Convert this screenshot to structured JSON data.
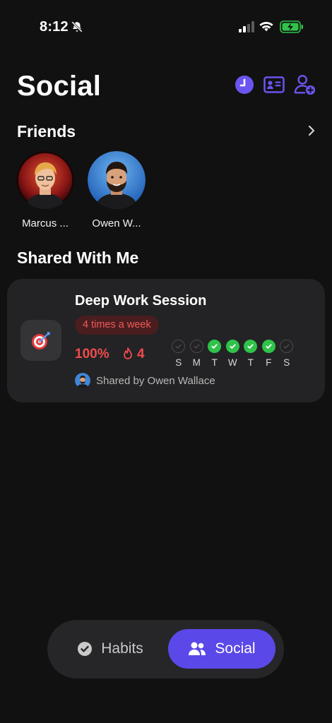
{
  "status_bar": {
    "time": "8:12"
  },
  "header": {
    "title": "Social"
  },
  "friends": {
    "title": "Friends",
    "items": [
      {
        "name": "Marcus ..."
      },
      {
        "name": "Owen W..."
      }
    ]
  },
  "shared": {
    "title": "Shared With Me",
    "habit": {
      "name": "Deep Work Session",
      "frequency": "4 times a week",
      "percent": "100%",
      "streak": "4",
      "days": [
        {
          "label": "S",
          "done": false
        },
        {
          "label": "M",
          "done": false
        },
        {
          "label": "T",
          "done": true
        },
        {
          "label": "W",
          "done": true
        },
        {
          "label": "T",
          "done": true
        },
        {
          "label": "F",
          "done": true
        },
        {
          "label": "S",
          "done": false
        }
      ],
      "shared_by": "Shared by Owen Wallace"
    }
  },
  "tabs": [
    {
      "label": "Habits",
      "active": false
    },
    {
      "label": "Social",
      "active": true
    }
  ],
  "colors": {
    "accent": "#5b48e8",
    "background": "#111112",
    "card": "#232325",
    "danger": "#f04b4b",
    "success": "#30c24a"
  },
  "icons": [
    "bell-off-icon",
    "signal-icon",
    "wifi-icon",
    "battery-charging-icon",
    "history-icon",
    "contact-card-icon",
    "add-friend-icon",
    "chevron-right-icon",
    "target-icon",
    "flame-icon",
    "checkmark-icon",
    "check-circle-icon",
    "people-icon"
  ]
}
